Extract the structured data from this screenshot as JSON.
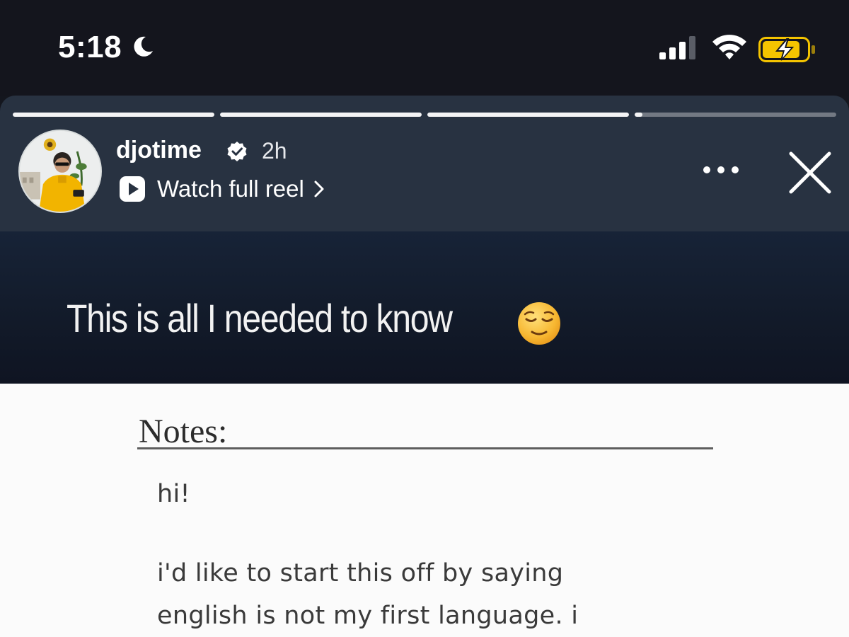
{
  "status_bar": {
    "time": "5:18",
    "focus_icon": "moon-icon",
    "signal_icon": "cellular-signal-icon",
    "wifi_icon": "wifi-icon",
    "battery_icon": "battery-charging-icon",
    "battery_color": "#f5c400"
  },
  "story": {
    "progress": [
      1.0,
      1.0,
      1.0,
      0.04
    ],
    "username": "djotime",
    "verified": true,
    "age": "2h",
    "watch_full_reel_label": "Watch full reel",
    "more_icon": "more-options-icon",
    "close_icon": "close-icon"
  },
  "content": {
    "caption": "This is all I needed to know",
    "caption_emoji": "relieved-face-emoji",
    "notes_heading": "Notes:",
    "greeting": "hi!",
    "body_lines": [
      "i'd like to start this off by saying",
      "english is not my first language. i"
    ]
  },
  "colors": {
    "status_bar_bg": "#14151d",
    "header_bg": "#283241",
    "caption_bg": "#172337",
    "note_bg": "#fbfbfb",
    "avatar_jacket": "#f2b400"
  }
}
